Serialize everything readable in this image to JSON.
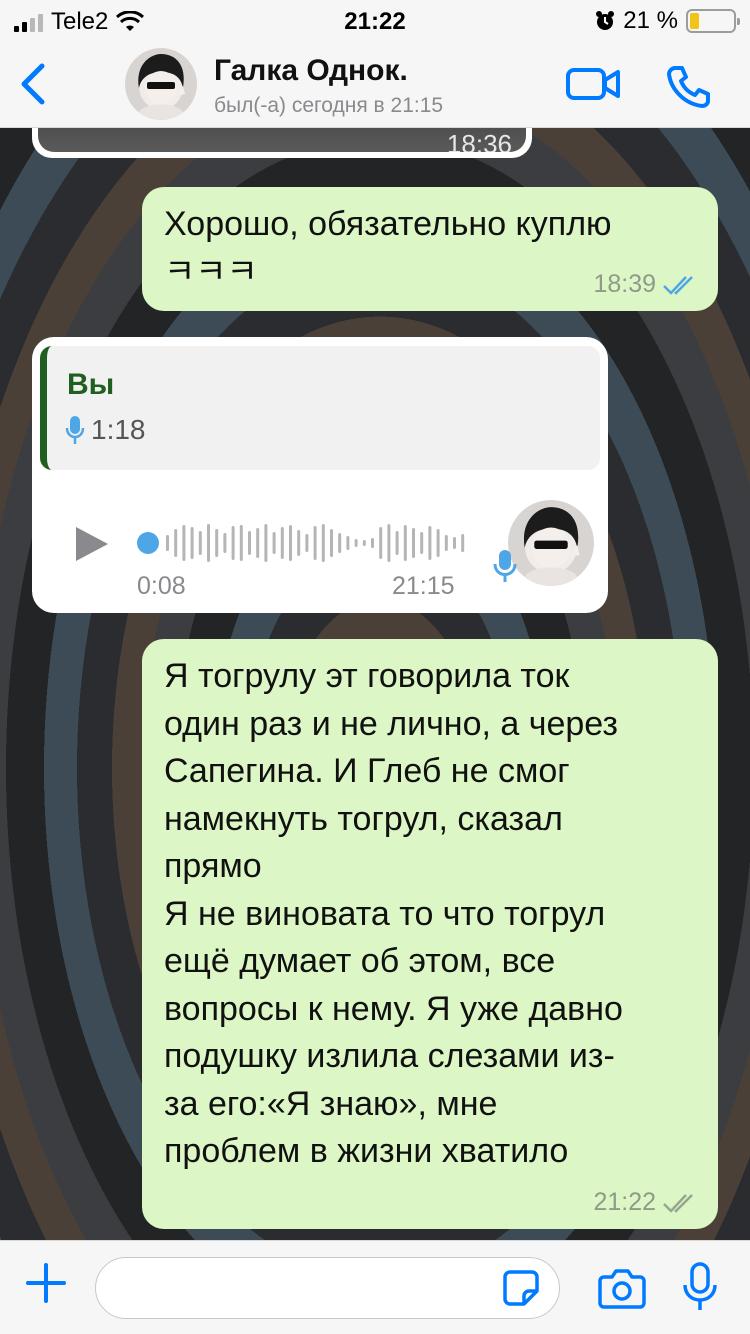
{
  "status_bar": {
    "carrier": "Tele2",
    "time": "21:22",
    "battery_percent": "21 %",
    "battery_level": 0.21
  },
  "header": {
    "contact_name": "Галка Однок.",
    "contact_status": "был(-а) сегодня в 21:15",
    "icons": [
      "back-chevron-icon",
      "video-camera-icon",
      "phone-icon"
    ]
  },
  "messages": [
    {
      "kind": "image",
      "direction": "incoming",
      "time": "18:36"
    },
    {
      "kind": "text",
      "direction": "outgoing",
      "text": "Хорошо, обязательно куплю\nㅋㅋㅋ",
      "time": "18:39",
      "status": "read"
    },
    {
      "kind": "voice",
      "direction": "incoming",
      "reply_to": {
        "author": "Вы",
        "duration": "1:18"
      },
      "duration": "0:08",
      "time": "21:15"
    },
    {
      "kind": "text",
      "direction": "outgoing",
      "text": "Я тогрулу эт говорила ток\nодин раз и не лично, а через\nСапегина. И Глеб не смог\nнамекнуть тогрул, сказал\nпрямо\nЯ не виновата то что тогрул\nещё думает об этом, все\nвопросы к нему. Я уже давно\nподушку излила слезами из-\nза его:«Я знаю», мне\nпроблем в жизни хватило",
      "time": "21:22",
      "status": "delivered"
    }
  ],
  "input_bar": {
    "placeholder": "",
    "icons": [
      "plus-icon",
      "sticker-icon",
      "camera-icon",
      "microphone-icon"
    ]
  },
  "colors": {
    "accent": "#007aff",
    "outgoing_bubble": "#dcf7c5",
    "incoming_bubble": "#ffffff",
    "quote_bar": "#1f5f1f",
    "read_ticks": "#4fa6e6",
    "battery_fill": "#f2c418"
  }
}
